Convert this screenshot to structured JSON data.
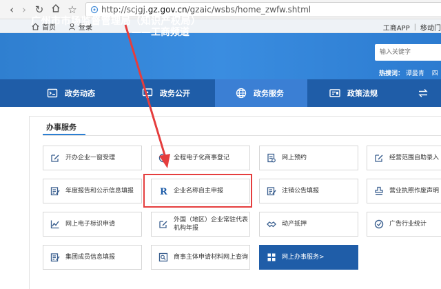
{
  "browser": {
    "url_prefix": "http://scjgj.",
    "url_domain": "gz.gov.cn",
    "url_path": "/gzaic/wsbs/home_zwfw.shtml"
  },
  "util_bar": {
    "home": "首页",
    "login": "登录",
    "app": "工商APP",
    "mobile": "移动门"
  },
  "header": {
    "title": "广州市市场监督管理局（知识产权局）",
    "subtitle": "——工商频道",
    "search_placeholder": "输入关键字",
    "hot_label": "热搜词：",
    "hot_words": [
      "谭曼青",
      "四"
    ]
  },
  "nav": {
    "tabs": [
      {
        "label": "政务动态",
        "icon": "news-icon"
      },
      {
        "label": "政务公开",
        "icon": "monitor-icon"
      },
      {
        "label": "政务服务",
        "icon": "globe-icon"
      },
      {
        "label": "政策法规",
        "icon": "id-card-icon"
      }
    ],
    "active": "政务服务"
  },
  "section": {
    "title": "办事服务"
  },
  "services": [
    {
      "label": "开办企业一窗受理",
      "icon": "edit-icon"
    },
    {
      "label": "全程电子化商事登记",
      "icon": "badge-icon"
    },
    {
      "label": "网上预约",
      "icon": "document-icon"
    },
    {
      "label": "经营范围自助录入",
      "icon": "edit-icon"
    },
    {
      "label": "年度报告和公示信息填报",
      "icon": "list-edit-icon"
    },
    {
      "label": "企业名称自主申报",
      "icon": "r-logo-icon"
    },
    {
      "label": "注销公告填报",
      "icon": "list-edit-icon"
    },
    {
      "label": "营业执照作废声明",
      "icon": "seal-icon"
    },
    {
      "label": "网上电子标识申请",
      "icon": "chart-icon"
    },
    {
      "label": "外国（地区）企业常驻代表机构年报",
      "icon": "edit-icon"
    },
    {
      "label": "动产抵押",
      "icon": "handshake-icon"
    },
    {
      "label": "广告行业统计",
      "icon": "badge-icon"
    },
    {
      "label": "集团成员信息填报",
      "icon": "list-edit-icon"
    },
    {
      "label": "商事主体申请材料网上查询",
      "icon": "search-doc-icon"
    },
    {
      "label": "网上办事服务>",
      "icon": "grid-icon"
    }
  ]
}
